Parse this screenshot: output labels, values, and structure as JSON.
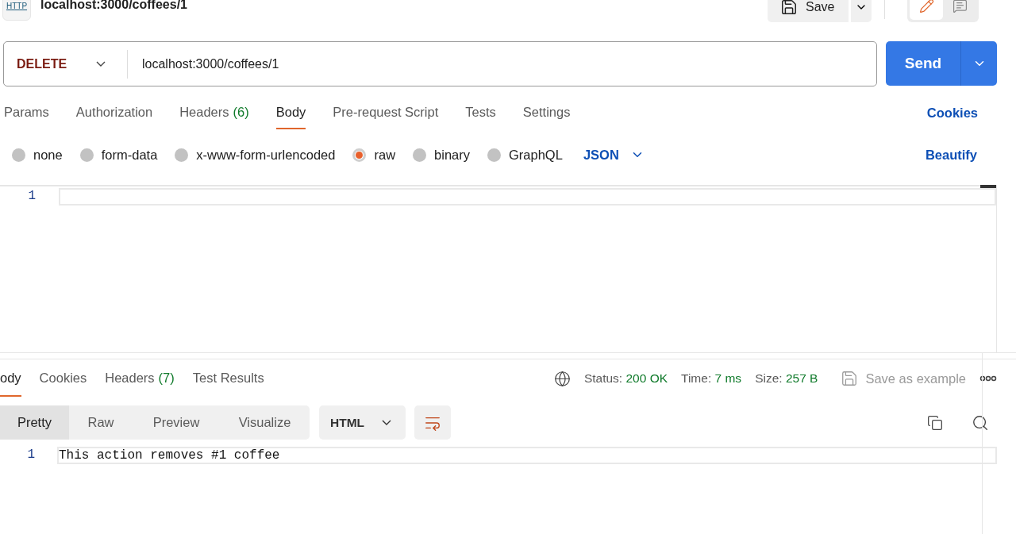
{
  "header": {
    "badge": "HTTP",
    "title": "localhost:3000/coffees/1",
    "save_label": "Save",
    "mode_toggle": [
      {
        "kind": "edit",
        "selected": true
      },
      {
        "kind": "comment",
        "selected": false
      }
    ]
  },
  "request": {
    "method": "DELETE",
    "url": "localhost:3000/coffees/1",
    "send_label": "Send"
  },
  "request_tabs": [
    {
      "label": "Params",
      "selected": false
    },
    {
      "label": "Authorization",
      "selected": false
    },
    {
      "label": "Headers",
      "count": "(6)",
      "selected": false
    },
    {
      "label": "Body",
      "selected": true
    },
    {
      "label": "Pre-request Script",
      "selected": false
    },
    {
      "label": "Tests",
      "selected": false
    },
    {
      "label": "Settings",
      "selected": false
    }
  ],
  "cookies_link": "Cookies",
  "body_types": [
    {
      "label": "none",
      "selected": false
    },
    {
      "label": "form-data",
      "selected": false
    },
    {
      "label": "x-www-form-urlencoded",
      "selected": false
    },
    {
      "label": "raw",
      "selected": true
    },
    {
      "label": "binary",
      "selected": false
    },
    {
      "label": "GraphQL",
      "selected": false
    }
  ],
  "body_format": "JSON",
  "beautify_link": "Beautify",
  "editor": {
    "line_numbers": [
      "1"
    ]
  },
  "response_tabs": [
    {
      "label": "ody",
      "selected": true
    },
    {
      "label": "Cookies",
      "selected": false
    },
    {
      "label": "Headers",
      "count": "(7)",
      "selected": false
    },
    {
      "label": "Test Results",
      "selected": false
    }
  ],
  "response_stats": [
    {
      "label": "Status:",
      "value": "200 OK"
    },
    {
      "label": "Time:",
      "value": "7 ms"
    },
    {
      "label": "Size:",
      "value": "257 B"
    }
  ],
  "save_example": "Save as example",
  "view_modes": [
    {
      "label": "Pretty",
      "selected": true
    },
    {
      "label": "Raw",
      "selected": false
    },
    {
      "label": "Preview",
      "selected": false
    },
    {
      "label": "Visualize",
      "selected": false
    }
  ],
  "response_language": "HTML",
  "response_lines": [
    {
      "number": "1",
      "text": "This action removes #1 coffee"
    }
  ]
}
